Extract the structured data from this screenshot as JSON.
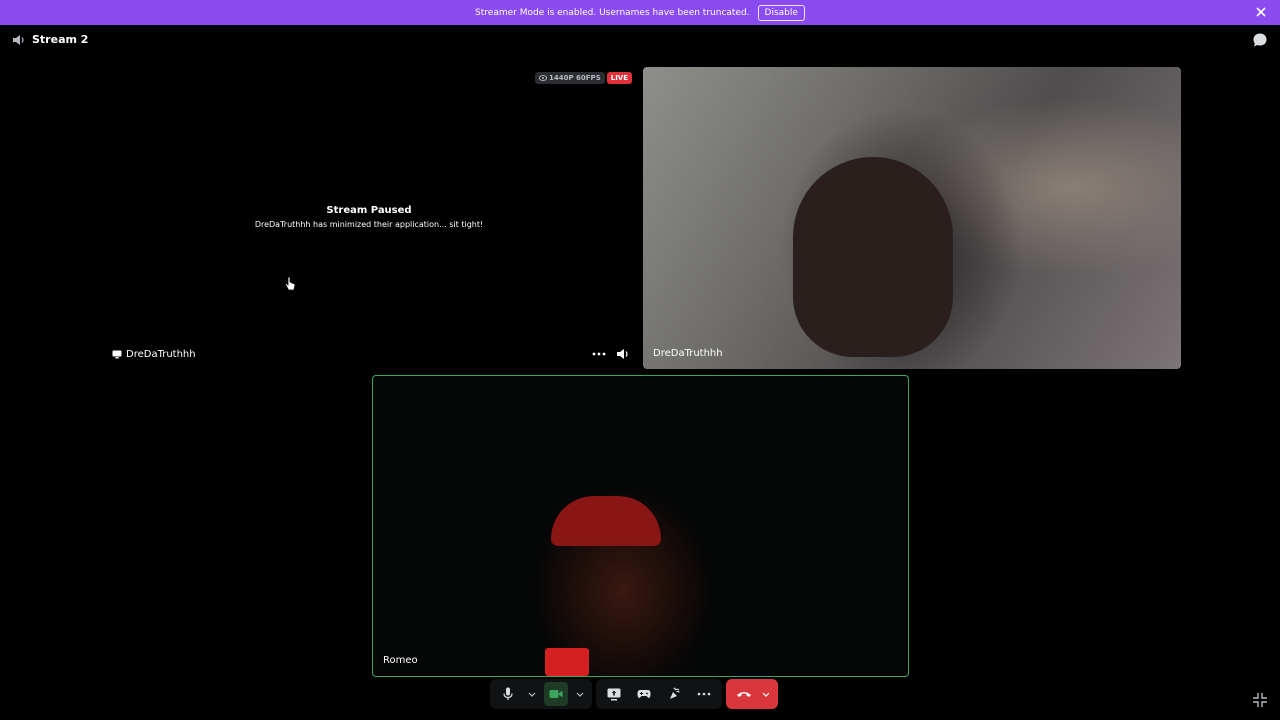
{
  "banner": {
    "message": "Streamer Mode is enabled. Usernames have been truncated.",
    "button_label": "Disable",
    "color": "#8a4bf0"
  },
  "channel": {
    "name": "Stream 2"
  },
  "stream_tile": {
    "quality_badge": "1440P 60FPS",
    "live_badge": "LIVE",
    "paused_title": "Stream Paused",
    "paused_message": "DreDaTruthhh has minimized their application... sit tight!",
    "streamer_name": "DreDaTruthhh"
  },
  "camera_tile": {
    "name": "DreDaTruthhh"
  },
  "self_tile": {
    "name": "Romeo",
    "speaking_color": "#3ba55d"
  },
  "icons": {
    "speaker": "speaker-icon",
    "chat": "chat-bubble-icon",
    "close": "close-icon",
    "more": "more-dots-icon",
    "mic": "mic-icon",
    "camera": "camera-icon",
    "screenshare": "screen-share-icon",
    "activity": "gamepad-icon",
    "soundboard": "soundboard-icon",
    "hangup": "hang-up-icon",
    "fullscreen": "exit-fullscreen-icon"
  },
  "colors": {
    "hangup": "#da373c",
    "live": "#e0323a"
  }
}
